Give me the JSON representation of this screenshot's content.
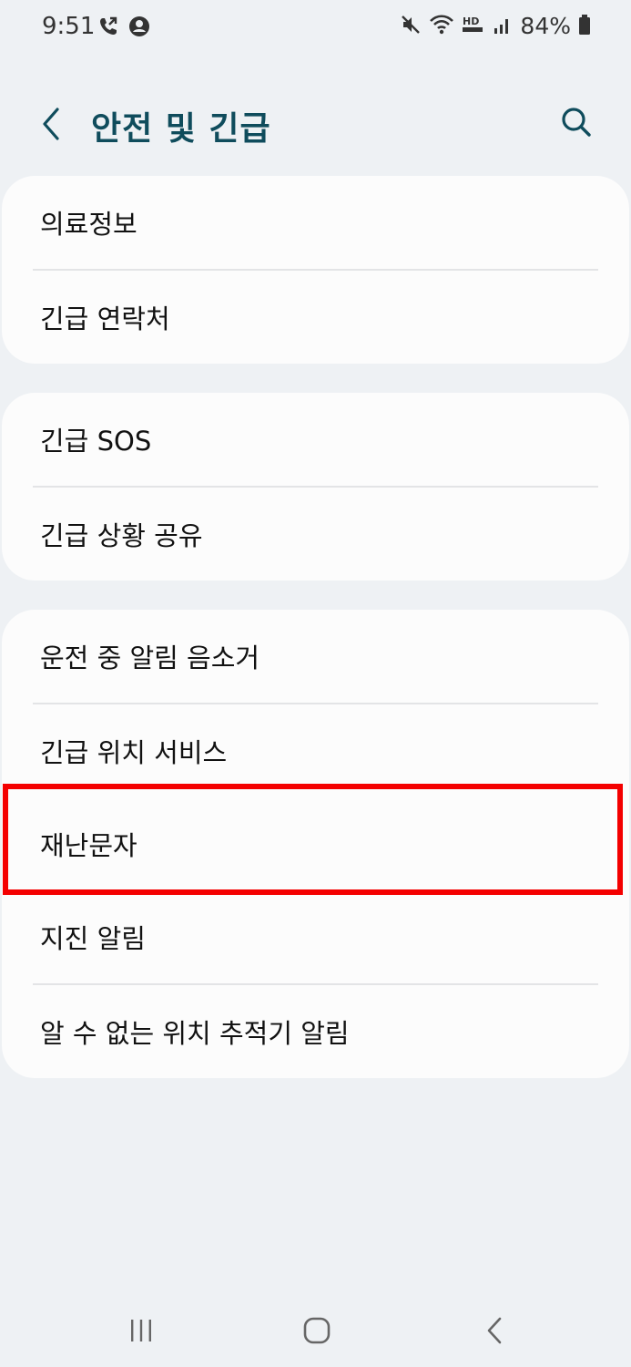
{
  "status_bar": {
    "time": "9:51",
    "battery": "84%",
    "icons": [
      "call-forward-icon",
      "account-circle-icon",
      "mute-icon",
      "wifi-icon",
      "hd-voice-icon",
      "signal-icon",
      "battery-icon"
    ]
  },
  "header": {
    "title": "안전 및 긴급",
    "back_icon": "back-arrow-icon",
    "search_icon": "search-icon"
  },
  "groups": [
    {
      "items": [
        "의료정보",
        "긴급 연락처"
      ]
    },
    {
      "items": [
        "긴급 SOS",
        "긴급 상황 공유"
      ]
    },
    {
      "items": [
        "운전 중 알림 음소거",
        "긴급 위치 서비스",
        "재난문자",
        "지진 알림",
        "알 수 없는 위치 추적기 알림"
      ]
    }
  ],
  "highlighted_item": "재난문자",
  "colors": {
    "background": "#eef1f4",
    "card": "#fcfcfc",
    "title": "#0f4c5c",
    "highlight": "#f40000"
  },
  "nav_bar": {
    "recents_icon": "recents-icon",
    "home_icon": "home-icon",
    "back_icon": "back-nav-icon"
  }
}
